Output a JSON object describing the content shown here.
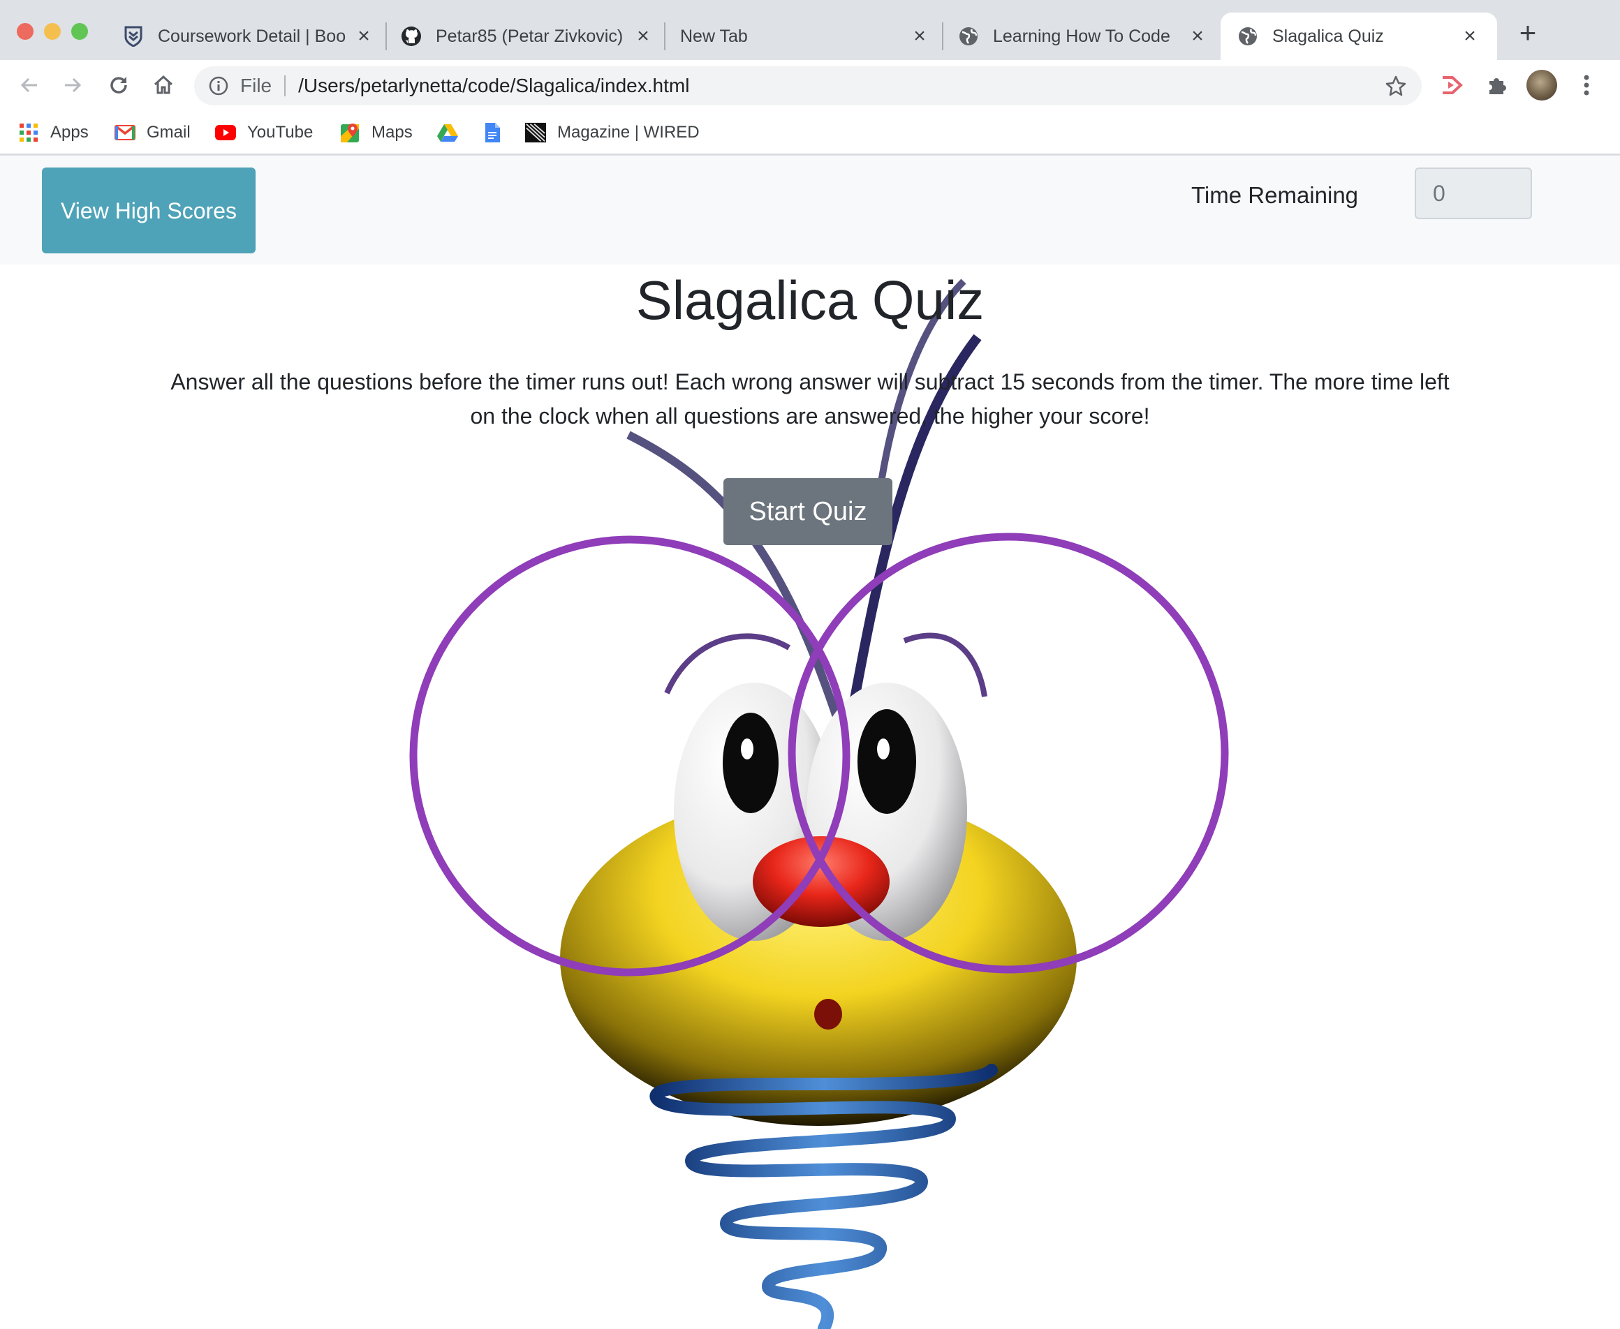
{
  "browser": {
    "tabs": [
      {
        "title": "Coursework Detail | Boo",
        "icon": "bootcamp-shield-icon",
        "active": false
      },
      {
        "title": "Petar85 (Petar Zivkovic)",
        "icon": "github-icon",
        "active": false
      },
      {
        "title": "New Tab",
        "icon": "",
        "active": false
      },
      {
        "title": "Learning How To Code",
        "icon": "globe-icon",
        "active": false
      },
      {
        "title": "Slagalica Quiz",
        "icon": "globe-icon",
        "active": true
      }
    ],
    "address": {
      "scheme": "File",
      "url": "/Users/petarlynetta/code/Slagalica/index.html"
    },
    "bookmarks": [
      {
        "label": "Apps",
        "icon": "apps-grid-icon"
      },
      {
        "label": "Gmail",
        "icon": "gmail-icon"
      },
      {
        "label": "YouTube",
        "icon": "youtube-icon"
      },
      {
        "label": "Maps",
        "icon": "maps-icon"
      },
      {
        "label": "",
        "icon": "drive-icon"
      },
      {
        "label": "",
        "icon": "docs-icon"
      },
      {
        "label": "Magazine | WIRED",
        "icon": "wired-icon"
      }
    ]
  },
  "page": {
    "high_scores_label": "View High Scores",
    "time_label": "Time Remaining",
    "time_value": "0",
    "title": "Slagalica Quiz",
    "intro": "Answer all the questions before the timer runs out! Each wrong answer will subtract 15 seconds from the timer. The more time left on the clock when all questions are answered, the higher your score!",
    "start_label": "Start Quiz"
  },
  "colors": {
    "high_scores_bg": "#4fa3b8",
    "start_bg": "#6c757d",
    "navbar_bg": "#f8f9fa"
  }
}
